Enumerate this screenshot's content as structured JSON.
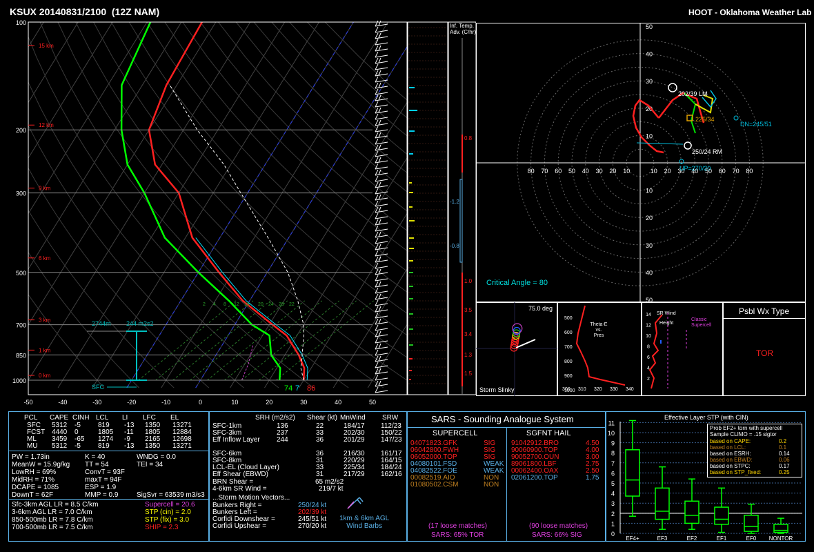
{
  "header": {
    "station": "KSUX 20140831/2100  (12Z NAM)",
    "lab": "HOOT - Oklahoma Weather Lab"
  },
  "skewt": {
    "pressure_labels": [
      "100",
      "200",
      "300",
      "500",
      "700",
      "850",
      "1000"
    ],
    "height_labels": [
      "15 km",
      "12 km",
      "9 km",
      "6 km",
      "3 km",
      "1 km",
      "0 km"
    ],
    "temp_ticks": [
      "-50",
      "-40",
      "-30",
      "-20",
      "-10",
      "0",
      "10",
      "20",
      "30",
      "40",
      "50"
    ],
    "mixing_ratio_labels": [
      "2",
      "4",
      "8",
      "12",
      "16",
      "20",
      "24",
      "28",
      "22"
    ],
    "eff_inflow_bottom": "2744m",
    "srh_label": "244 m2s2",
    "sfc_label": "SFC",
    "sfc_td": "74",
    "sfc_7": "7",
    "sfc_t": "86",
    "inf_temp_adv_label": "Inf. Temp.\nAdv. (C/hr)",
    "adv_values": [
      "0.8",
      "-1.2",
      "-0.8",
      "1.0",
      "3.5",
      "3.4",
      "1.3",
      "1.5"
    ]
  },
  "hodograph": {
    "rings_y": [
      "60",
      "50",
      "40",
      "30",
      "20",
      "10",
      "10",
      "20",
      "30",
      "40",
      "50",
      "60"
    ],
    "rings_x": [
      "80",
      "70",
      "60",
      "50",
      "40",
      "30",
      "20",
      "10",
      "10",
      "20",
      "30",
      "40",
      "50",
      "60",
      "70",
      "80"
    ],
    "lm_label": "202/39 LM",
    "rm_label": "250/24 RM",
    "dn_label": "DN=245/51",
    "up_label": "UP=270/20",
    "mean_label": "225/34",
    "critical_angle": "Critical Angle = 80"
  },
  "slinky": {
    "title": "Storm Slinky",
    "angle": "75.0 deg"
  },
  "theta": {
    "title": "Theta-E\nvs.\nPres",
    "pres_ticks": [
      "500",
      "600",
      "700",
      "800",
      "900",
      "1000"
    ],
    "theta_ticks": [
      "300",
      "310",
      "320",
      "330",
      "340",
      "35"
    ]
  },
  "srwind": {
    "title": "SR Wind\nvs.\nHeight",
    "classic": "Classic\nSupercell",
    "heights": [
      "14",
      "12",
      "10",
      "8",
      "6",
      "4",
      "2"
    ],
    "speeds": [
      "0",
      "20",
      "40",
      "60",
      "80"
    ]
  },
  "wxtype": {
    "title": "Psbl Wx Type",
    "value": "TOR"
  },
  "parcels": {
    "headers": [
      "PCL",
      "CAPE",
      "CINH",
      "LCL",
      "LI",
      "LFC",
      "EL"
    ],
    "rows": [
      [
        "SFC",
        "5312",
        "-5",
        "819",
        "-13",
        "1350",
        "13271"
      ],
      [
        "FCST",
        "4440",
        "0",
        "1805",
        "-11",
        "1805",
        "12884"
      ],
      [
        "ML",
        "3459",
        "-65",
        "1274",
        "-9",
        "2165",
        "12698"
      ],
      [
        "MU",
        "5312",
        "-5",
        "819",
        "-13",
        "1350",
        "13271"
      ]
    ]
  },
  "indices_left": [
    "PW = 1.73in",
    "MeanW = 15.9g/kg",
    "LowRH = 69%",
    "MidRH = 71%",
    "DCAPE = 1085",
    "DownT = 62F"
  ],
  "indices_mid": [
    "K = 40",
    "TT = 54",
    "ConvT = 93F",
    "maxT = 94F",
    "ESP = 1.9",
    "MMP = 0.9"
  ],
  "indices_right": [
    "WNDG = 0.0",
    "TEI = 34",
    "",
    "",
    "",
    "SigSvr = 63539 m3/s3"
  ],
  "lapse_rates": [
    "Sfc-3km AGL LR = 8.5 C/km",
    "3-6km AGL LR = 7.0 C/km",
    "850-500mb LR = 7.8 C/km",
    "700-500mb LR = 7.5 C/km"
  ],
  "composites": [
    {
      "text": "Supercell = 20.6",
      "color": "#e040e0"
    },
    {
      "text": "STP (cin) = 2.0",
      "color": "#ffff00"
    },
    {
      "text": "STP (fix) = 3.0",
      "color": "#ffff00"
    },
    {
      "text": "SHIP = 2.3",
      "color": "#ff2020"
    }
  ],
  "kinematics": {
    "headers": [
      "SRH (m2/s2)",
      "Shear (kt)",
      "MnWind",
      "SRW"
    ],
    "rows": [
      [
        "SFC-1km",
        "136",
        "22",
        "184/17",
        "112/23"
      ],
      [
        "SFC-3km",
        "237",
        "33",
        "202/30",
        "150/22"
      ],
      [
        "Eff Inflow Layer",
        "244",
        "36",
        "201/29",
        "147/23"
      ],
      [
        "",
        "",
        "",
        "",
        ""
      ],
      [
        "SFC-6km",
        "",
        "36",
        "216/30",
        "161/17"
      ],
      [
        "SFC-8km",
        "",
        "31",
        "220/29",
        "164/15"
      ],
      [
        "LCL-EL (Cloud Layer)",
        "",
        "33",
        "225/34",
        "184/24"
      ],
      [
        "Eff Shear (EBWD)",
        "",
        "31",
        "217/29",
        "162/16"
      ]
    ],
    "brn_shear": "BRN Shear =",
    "brn_val": "65 m2/s2",
    "sr_wind": "4-6km SR Wind =",
    "sr_wind_val": "219/7 kt",
    "motion_title": "...Storm Motion Vectors...",
    "motions": [
      {
        "label": "Bunkers Right =",
        "value": "250/24 kt",
        "color": "#5ab0e6"
      },
      {
        "label": "Bunkers Left =",
        "value": "202/39 kt",
        "color": "#ff2020"
      },
      {
        "label": "Corfidi Downshear =",
        "value": "245/51 kt",
        "color": "#ffffff"
      },
      {
        "label": "Corfidi Upshear =",
        "value": "270/20 kt",
        "color": "#ffffff"
      }
    ],
    "barb_label": "1km & 6km AGL\nWind Barbs"
  },
  "sars": {
    "title": "SARS - Sounding Analogue System",
    "supercell_head": "SUPERCELL",
    "hail_head": "SGFNT HAIL",
    "supercell": [
      {
        "id": "04071823.GFK",
        "tag": "SIG",
        "color": "#ff2020"
      },
      {
        "id": "06042800.FWH",
        "tag": "SIG",
        "color": "#ff2020"
      },
      {
        "id": "06052000.TOP",
        "tag": "SIG",
        "color": "#ff2020"
      },
      {
        "id": "04080101.FSD",
        "tag": "WEAK",
        "color": "#5ab0e6"
      },
      {
        "id": "04082522.FOE",
        "tag": "WEAK",
        "color": "#5ab0e6"
      },
      {
        "id": "00082519.AIO",
        "tag": "NON",
        "color": "#c08020"
      },
      {
        "id": "01080502.CSM",
        "tag": "NON",
        "color": "#c08020"
      }
    ],
    "hail": [
      {
        "id": "91042912.BRO",
        "tag": "4.50",
        "color": "#ff2020"
      },
      {
        "id": "90060900.TOP",
        "tag": "4.00",
        "color": "#ff2020"
      },
      {
        "id": "90052700.OUN",
        "tag": "3.00",
        "color": "#ff2020"
      },
      {
        "id": "89061800.LBF",
        "tag": "2.75",
        "color": "#ff2020"
      },
      {
        "id": "00062400.OAX",
        "tag": "2.50",
        "color": "#ff2020"
      },
      {
        "id": "02061200.TOP",
        "tag": "1.75",
        "color": "#5ab0e6"
      }
    ],
    "sc_matches": "(17 loose matches)",
    "sc_prob": "SARS: 65% TOR",
    "hail_matches": "(90 loose matches)",
    "hail_prob": "SARS: 66% SIG"
  },
  "stp": {
    "title": "Effective Layer STP (with CIN)",
    "legend_title": "Prob EF2+ torn with supercell\nSample CLIMO = .15 sigtor",
    "legend": [
      {
        "label": "based on CAPE:",
        "value": "0.2",
        "color": "#ffd700"
      },
      {
        "label": "based on LCL:",
        "value": "0.1",
        "color": "#c08020"
      },
      {
        "label": "based on ESRH:",
        "value": "0.14",
        "color": "#ffffff"
      },
      {
        "label": "based on EBWD:",
        "value": "0.06",
        "color": "#c08020"
      },
      {
        "label": "based on STPC:",
        "value": "0.17",
        "color": "#ffffff"
      },
      {
        "label": "based on STP_fixed:",
        "value": "0.25",
        "color": "#ffd700"
      }
    ],
    "y_ticks": [
      "11",
      "10",
      "9",
      "8",
      "7",
      "6",
      "5",
      "4",
      "3",
      "2",
      "1",
      "0"
    ],
    "categories": [
      "EF4+",
      "EF3",
      "EF2",
      "EF1",
      "EF0",
      "NONTOR"
    ]
  },
  "chart_data": [
    {
      "type": "line",
      "title": "KSUX 20140831/2100  (12Z NAM)",
      "xlabel": "Temperature (C)",
      "ylabel": "Pressure (mb)",
      "xlim": [
        -50,
        50
      ],
      "ylim": [
        1000,
        100
      ],
      "y_log": true,
      "series": [
        {
          "name": "Temperature",
          "color": "#ff2020",
          "points": [
            [
              30,
              1000
            ],
            [
              28,
              925
            ],
            [
              24,
              850
            ],
            [
              17,
              750
            ],
            [
              11,
              700
            ],
            [
              -2,
              600
            ],
            [
              -14,
              500
            ],
            [
              -28,
              400
            ],
            [
              -40,
              300
            ],
            [
              -52,
              250
            ],
            [
              -60,
              200
            ],
            [
              -63,
              150
            ],
            [
              -64,
              100
            ]
          ]
        },
        {
          "name": "Dewpoint",
          "color": "#00ff00",
          "points": [
            [
              23,
              1000
            ],
            [
              21,
              925
            ],
            [
              16,
              850
            ],
            [
              12,
              750
            ],
            [
              5,
              700
            ],
            [
              -6,
              600
            ],
            [
              -20,
              500
            ],
            [
              -36,
              400
            ],
            [
              -50,
              300
            ],
            [
              -60,
              250
            ],
            [
              -68,
              200
            ],
            [
              -76,
              150
            ],
            [
              -79,
              100
            ]
          ]
        },
        {
          "name": "Virtual Temperature",
          "color": "#00e0ff",
          "points": [
            [
              31,
              1000
            ],
            [
              29,
              925
            ],
            [
              25,
              850
            ],
            [
              18,
              750
            ],
            [
              12,
              700
            ],
            [
              -1,
              600
            ],
            [
              -13,
              500
            ],
            [
              -27,
              400
            ]
          ]
        },
        {
          "name": "Parcel",
          "color": "#ffffff",
          "points": [
            [
              30,
              1000
            ],
            [
              27,
              925
            ],
            [
              25,
              850
            ],
            [
              22,
              750
            ],
            [
              20,
              700
            ],
            [
              14,
              600
            ],
            [
              6,
              500
            ],
            [
              -6,
              400
            ],
            [
              -22,
              300
            ],
            [
              -32,
              250
            ],
            [
              -46,
              200
            ],
            [
              -62,
              150
            ]
          ]
        }
      ]
    },
    {
      "type": "box",
      "title": "Effective Layer STP (with CIN)",
      "categories": [
        "EF4+",
        "EF3",
        "EF2",
        "EF1",
        "EF0",
        "NONTOR"
      ],
      "ylim": [
        0,
        11
      ],
      "boxes": [
        {
          "whisker_low": 1.7,
          "q1": 3.7,
          "median": 5.3,
          "q3": 8.3,
          "whisker_high": 11.2
        },
        {
          "whisker_low": 0.4,
          "q1": 1.4,
          "median": 2.2,
          "q3": 4.5,
          "whisker_high": 6.6
        },
        {
          "whisker_low": 0.4,
          "q1": 1.0,
          "median": 1.8,
          "q3": 3.2,
          "whisker_high": 5.4
        },
        {
          "whisker_low": 0.1,
          "q1": 0.9,
          "median": 1.4,
          "q3": 2.6,
          "whisker_high": 4.5
        },
        {
          "whisker_low": 0.0,
          "q1": 0.2,
          "median": 0.7,
          "q3": 1.8,
          "whisker_high": 2.9
        },
        {
          "whisker_low": 0.0,
          "q1": 0.1,
          "median": 0.3,
          "q3": 0.9,
          "whisker_high": 1.5
        }
      ],
      "observed": 2.0
    }
  ]
}
